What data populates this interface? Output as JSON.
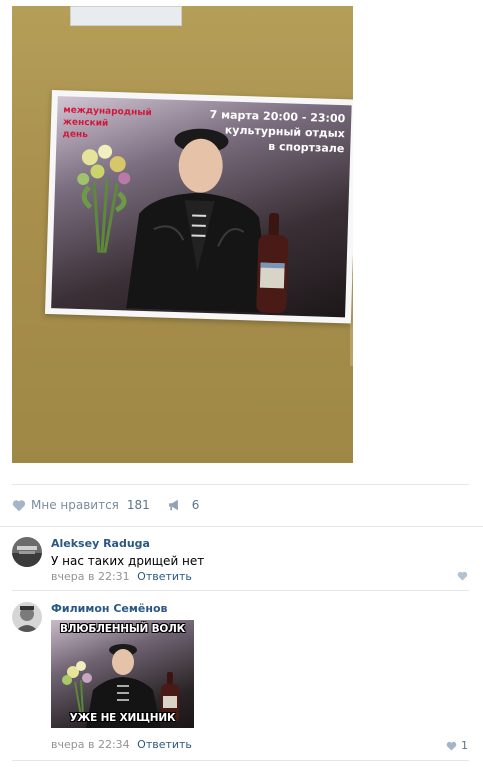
{
  "poster": {
    "left_text_lines": [
      "международный",
      "женский",
      "день"
    ],
    "right_text_lines": [
      "7 марта 20:00 - 23:00",
      "культурный отдых",
      "в спортзале"
    ]
  },
  "actions": {
    "like_label": "Мне нравится",
    "like_count": "181",
    "share_count": "6"
  },
  "comments": [
    {
      "author": "Aleksey Raduga",
      "text": "У нас таких дрищей нет",
      "time": "вчера в 22:31",
      "reply": "Ответить",
      "likes": ""
    },
    {
      "author": "Филимон Семёнов",
      "meme_top": "ВЛЮБЛЕННЫЙ ВОЛК",
      "meme_bottom": "УЖЕ НЕ ХИЩНИК",
      "time": "вчера в 22:34",
      "reply": "Ответить",
      "likes": "1"
    }
  ],
  "colors": {
    "link": "#2a5885",
    "meta": "#939393",
    "icon": "#7a8d9e",
    "poster_red": "#d0183d"
  }
}
